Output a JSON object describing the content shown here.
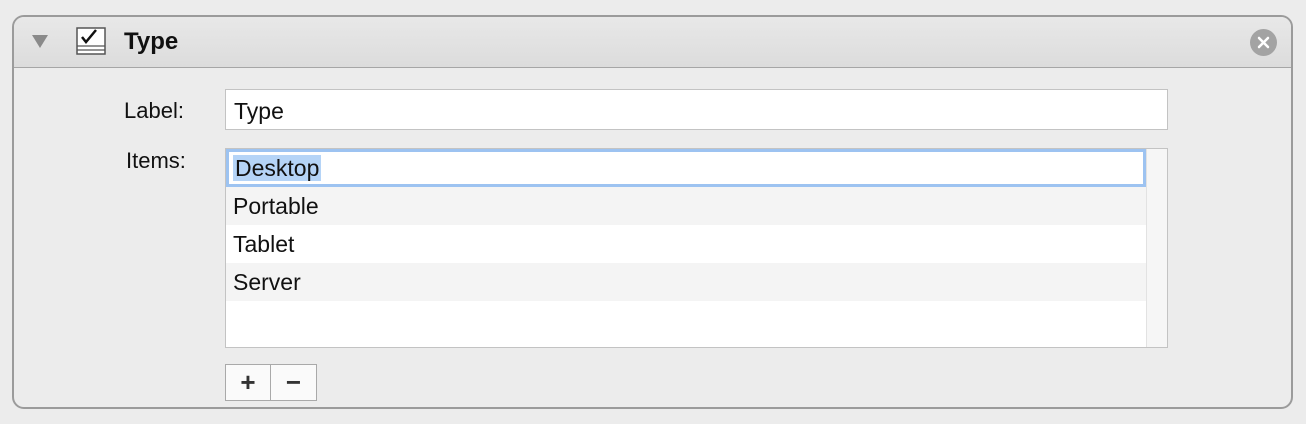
{
  "header": {
    "title": "Type",
    "disclosure_icon": "disclosure-triangle-icon",
    "type_icon": "checkbox-list-icon",
    "close_icon": "close-circle-icon"
  },
  "form": {
    "label_caption": "Label:",
    "label_value": "Type",
    "items_caption": "Items:"
  },
  "items": [
    {
      "label": "Desktop",
      "state": "editing"
    },
    {
      "label": "Portable"
    },
    {
      "label": "Tablet"
    },
    {
      "label": "Server"
    }
  ],
  "buttons": {
    "add_label": "+",
    "remove_label": "−"
  },
  "colors": {
    "selection": "#b5d4f7",
    "focus_ring": "#9dc3f1",
    "close_button": "#a3a3a3"
  }
}
